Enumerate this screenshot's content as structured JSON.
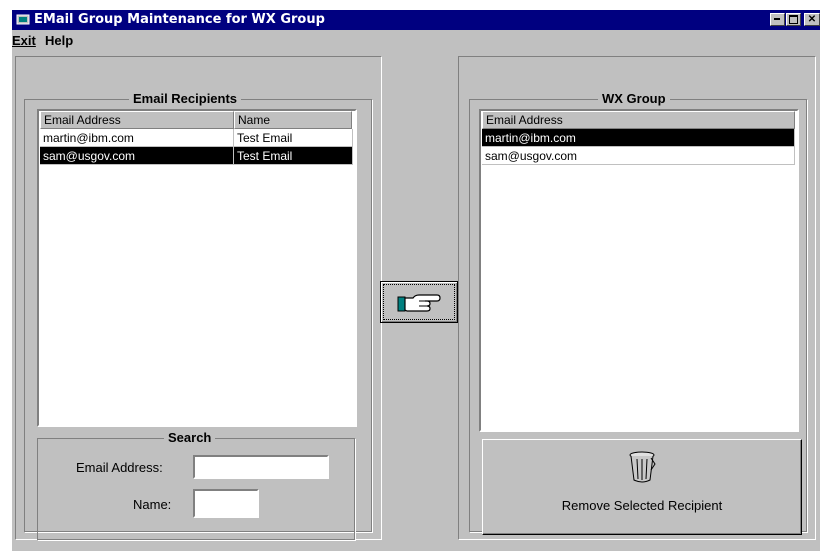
{
  "window": {
    "title": "EMail Group Maintenance for WX Group"
  },
  "menu": {
    "exit": "Exit",
    "help": "Help"
  },
  "recipients": {
    "title": "Email Recipients",
    "columns": [
      "Email Address",
      "Name"
    ],
    "rows": [
      {
        "email": "martin@ibm.com",
        "name": "Test Email",
        "selected": false
      },
      {
        "email": "sam@usgov.com",
        "name": "Test Email",
        "selected": true
      }
    ]
  },
  "search": {
    "title": "Search",
    "email_label": "Email Address:",
    "email_value": "",
    "name_label": "Name:",
    "name_value": ""
  },
  "group": {
    "title": "WX Group",
    "column": "Email Address",
    "rows": [
      {
        "email": "martin@ibm.com",
        "selected": true
      },
      {
        "email": "sam@usgov.com",
        "selected": false
      }
    ]
  },
  "buttons": {
    "add_icon": "pointing-hand-icon",
    "remove_label": "Remove Selected Recipient",
    "remove_icon": "trash-can-icon"
  }
}
